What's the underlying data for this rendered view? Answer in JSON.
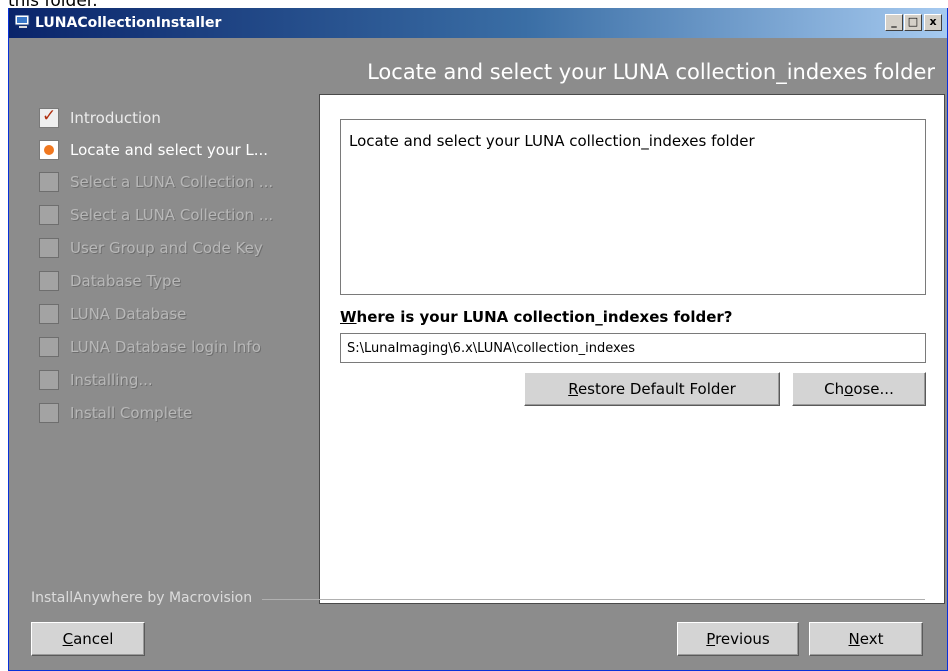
{
  "doc_text": "this folder.",
  "window": {
    "title": "LUNACollectionInstaller",
    "minimize": "_",
    "maximize": "□",
    "close": "x"
  },
  "header_title": "Locate and select your LUNA collection_indexes folder",
  "steps": [
    {
      "label": "Introduction",
      "state": "done"
    },
    {
      "label": "Locate and select your L...",
      "state": "current"
    },
    {
      "label": "Select a LUNA Collection ...",
      "state": "todo"
    },
    {
      "label": "Select a LUNA Collection ...",
      "state": "todo"
    },
    {
      "label": "User Group and Code Key",
      "state": "todo"
    },
    {
      "label": "Database Type",
      "state": "todo"
    },
    {
      "label": "LUNA Database",
      "state": "todo"
    },
    {
      "label": "LUNA Database login Info",
      "state": "todo"
    },
    {
      "label": "Installing...",
      "state": "todo"
    },
    {
      "label": "Install Complete",
      "state": "todo"
    }
  ],
  "panel": {
    "description": "Locate and select your LUNA collection_indexes folder",
    "question_underlined": "W",
    "question_rest": "here is your LUNA collection_indexes folder?",
    "path_value": "S:\\LunaImaging\\6.x\\LUNA\\collection_indexes",
    "restore_button": {
      "mnemonic": "R",
      "rest": "estore Default Folder"
    },
    "choose_button": {
      "before": "Ch",
      "mnemonic": "o",
      "rest": "ose..."
    }
  },
  "footer": {
    "vendor": "InstallAnywhere by Macrovision",
    "cancel": {
      "mnemonic": "C",
      "rest": "ancel"
    },
    "previous": {
      "mnemonic": "P",
      "rest": "revious"
    },
    "next": {
      "mnemonic": "N",
      "rest": "ext"
    }
  }
}
